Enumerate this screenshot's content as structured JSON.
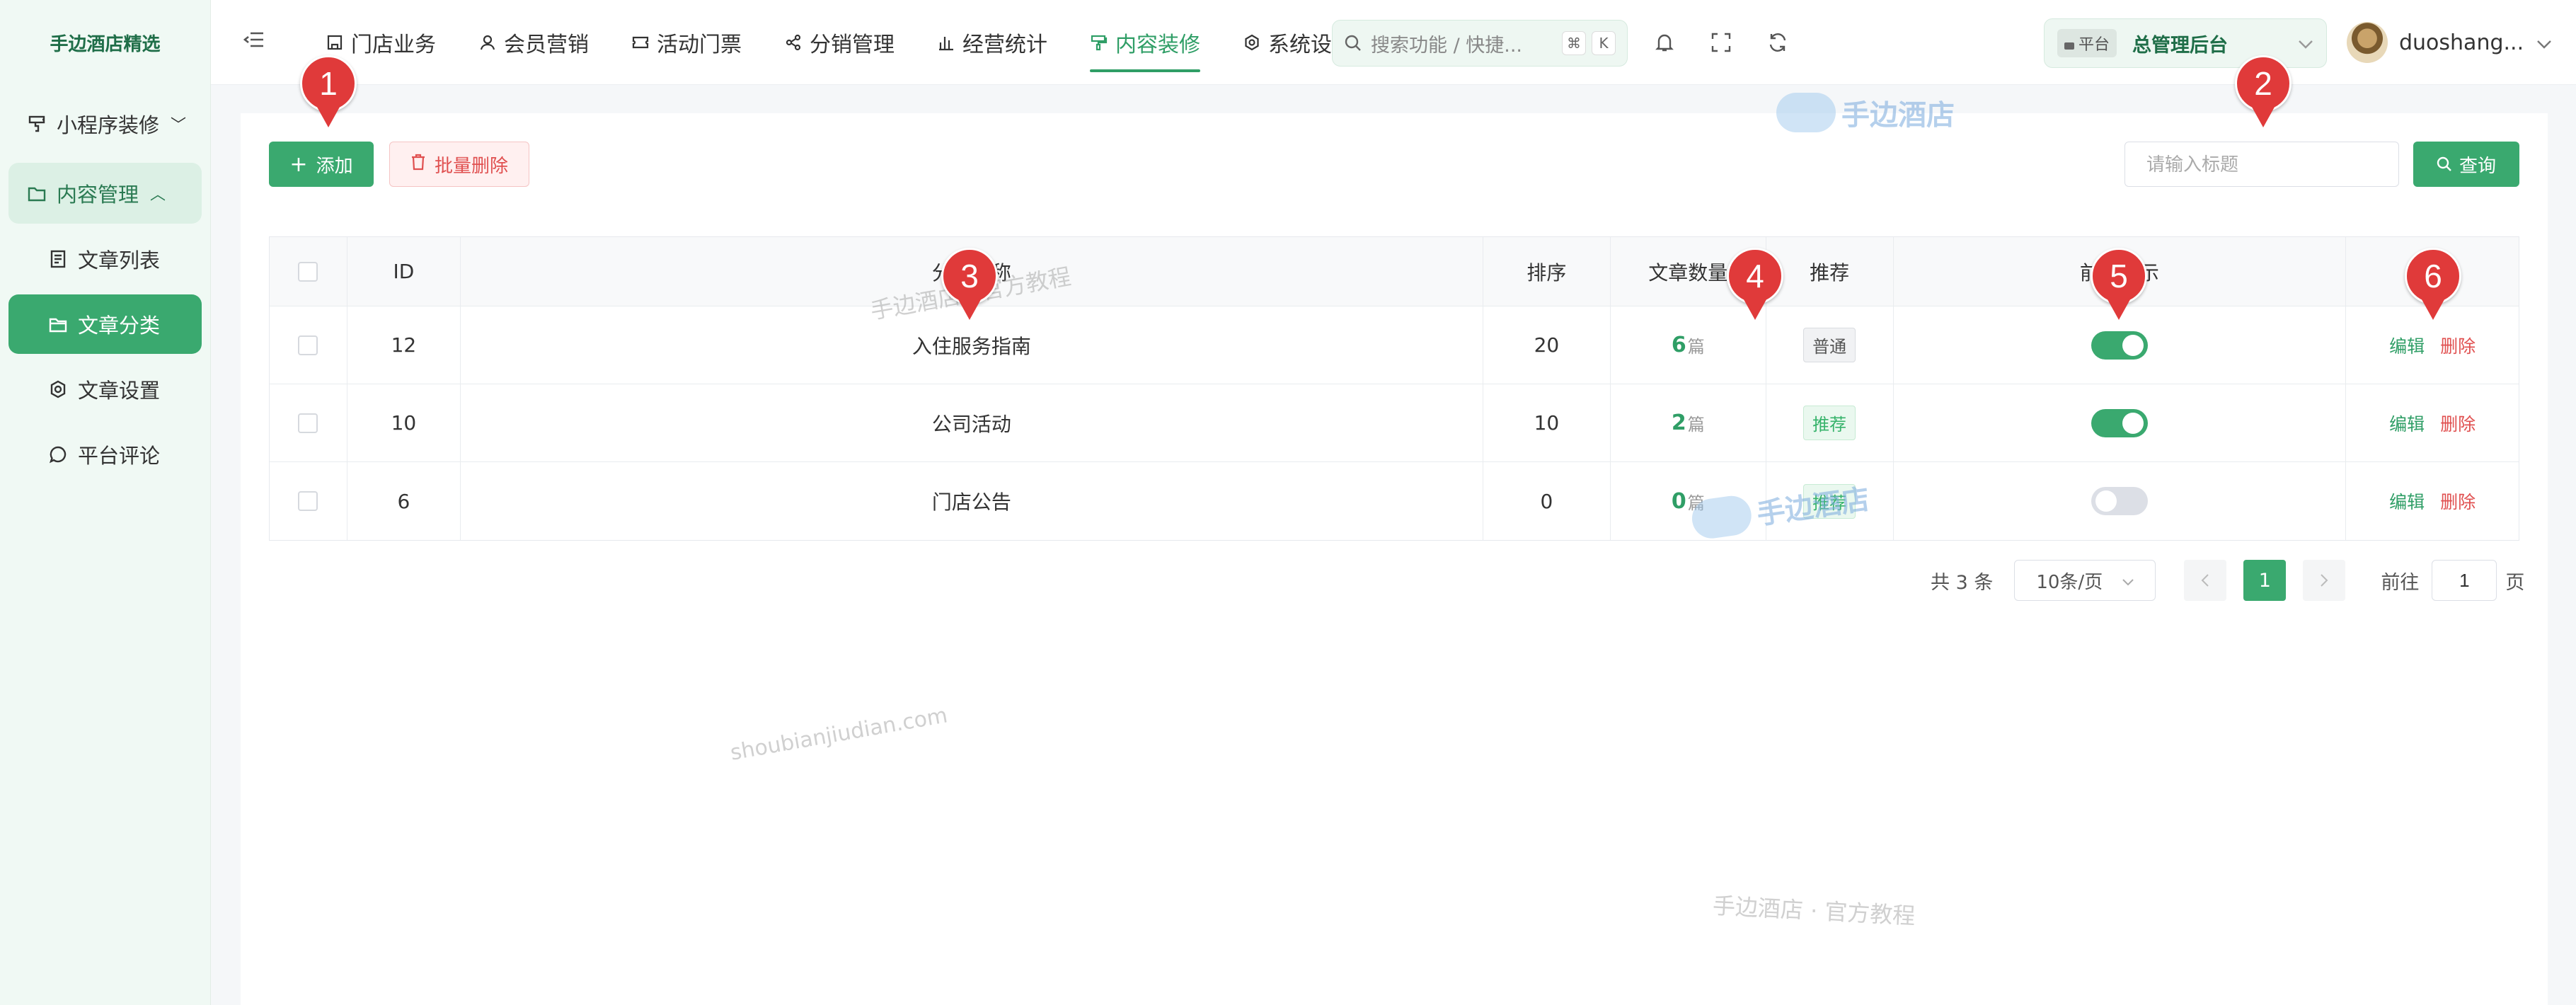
{
  "sidebar": {
    "logo": "手边酒店精选",
    "groups": [
      {
        "label": "小程序装修",
        "icon": "brush-icon",
        "chevron": "﹀"
      },
      {
        "label": "内容管理",
        "icon": "folder-icon",
        "chevron": "︿"
      }
    ],
    "items": [
      {
        "label": "文章列表",
        "icon": "document-icon"
      },
      {
        "label": "文章分类",
        "icon": "folder-icon"
      },
      {
        "label": "文章设置",
        "icon": "gear-icon"
      },
      {
        "label": "平台评论",
        "icon": "comment-icon"
      }
    ]
  },
  "header": {
    "menu": [
      {
        "label": "门店业务",
        "icon": "store-icon"
      },
      {
        "label": "会员营销",
        "icon": "user-icon"
      },
      {
        "label": "活动门票",
        "icon": "ticket-icon"
      },
      {
        "label": "分销管理",
        "icon": "share-icon"
      },
      {
        "label": "经营统计",
        "icon": "bar-chart-icon"
      },
      {
        "label": "内容装修",
        "icon": "brush-icon"
      },
      {
        "label": "系统设置",
        "icon": "gear-icon"
      }
    ],
    "search_placeholder": "搜索功能 / 快捷...",
    "shortcut": [
      "⌘",
      "K"
    ],
    "platform_tag": "平台",
    "platform_name": "总管理后台",
    "username": "duoshang..."
  },
  "toolbar": {
    "add_label": "添加",
    "batch_delete_label": "批量删除",
    "title_placeholder": "请输入标题",
    "query_label": "查询"
  },
  "table": {
    "columns": [
      "ID",
      "分类名称",
      "排序",
      "文章数量",
      "推荐",
      "前台显示"
    ],
    "count_unit": "篇",
    "edit_label": "编辑",
    "delete_label": "删除",
    "rows": [
      {
        "id": "12",
        "name": "入住服务指南",
        "sort": "20",
        "count": "6",
        "recommend": "普通",
        "recommend_type": "normal",
        "visible": true
      },
      {
        "id": "10",
        "name": "公司活动",
        "sort": "10",
        "count": "2",
        "recommend": "推荐",
        "recommend_type": "recommend",
        "visible": true
      },
      {
        "id": "6",
        "name": "门店公告",
        "sort": "0",
        "count": "0",
        "recommend": "推荐",
        "recommend_type": "recommend",
        "visible": false
      }
    ]
  },
  "pagination": {
    "total_text": "共 3 条",
    "page_size": "10条/页",
    "current_page": "1",
    "goto_prefix": "前往",
    "goto_value": "1",
    "goto_suffix": "页"
  },
  "watermarks": {
    "brand": "手边酒店",
    "tutorial_inline": "手边酒店 · 官方教程",
    "tutorial": "手边酒店 · 官方教程",
    "domain": "shoubianjiudian.com"
  },
  "markers": [
    "1",
    "2",
    "3",
    "4",
    "5",
    "6"
  ],
  "colors": {
    "accent": "#3aa96f",
    "danger": "#e05050",
    "marker": "#e03a3a"
  }
}
